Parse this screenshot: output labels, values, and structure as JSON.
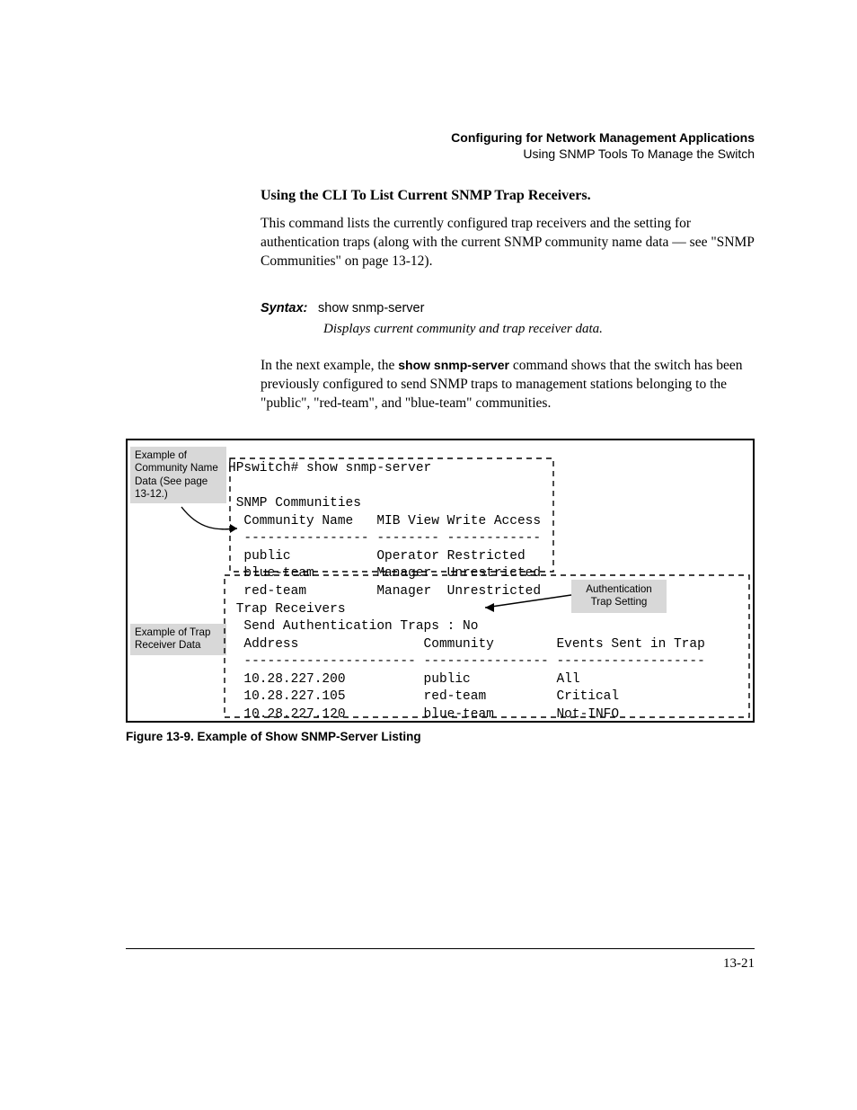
{
  "header": {
    "title": "Configuring for Network Management Applications",
    "subtitle": "Using SNMP Tools To Manage the Switch"
  },
  "section": {
    "heading": "Using the CLI To List Current SNMP Trap Receivers.",
    "intro": "This command lists the currently configured trap receivers and the setting for authentication traps (along with the current SNMP community name data — see \"SNMP Communities\" on page 13-12).",
    "syntax_label": "Syntax:",
    "syntax_cmd": "show snmp-server",
    "syntax_desc": "Displays current community and trap receiver data.",
    "para2_a": "In the next example, the ",
    "para2_bold": "show snmp-server",
    "para2_b": " command shows that the switch has been previously configured to send SNMP traps to management stations belonging to the \"public\", \"red-team\", and \"blue-team\" communities."
  },
  "callouts": {
    "c1": "Example of Community Name Data (See page 13-12.)",
    "c2": "Example of Trap Receiver Data",
    "c3": "Authentication Trap Setting"
  },
  "terminal": {
    "prompt": "HPswitch# show snmp-server",
    "sec1_title": " SNMP Communities",
    "sec1_hdr": "  Community Name   MIB View Write Access",
    "sec1_sep": "  ---------------- -------- ------------",
    "sec1_r1": "  public           Operator Restricted",
    "sec1_r2": "  blue-team        Manager  Unrestricted",
    "sec1_r3": "  red-team         Manager  Unrestricted",
    "sec2_title": " Trap Receivers",
    "sec2_auth": "  Send Authentication Traps : No",
    "sec2_hdr": "  Address                Community        Events Sent in Trap",
    "sec2_sep": "  ---------------------- ---------------- -------------------",
    "sec2_r1": "  10.28.227.200          public           All",
    "sec2_r2": "  10.28.227.105          red-team         Critical",
    "sec2_r3": "  10.28.227.120          blue-team        Not-INFO"
  },
  "figure_caption": "Figure 13-9.  Example of Show SNMP-Server Listing",
  "page_number": "13-21"
}
